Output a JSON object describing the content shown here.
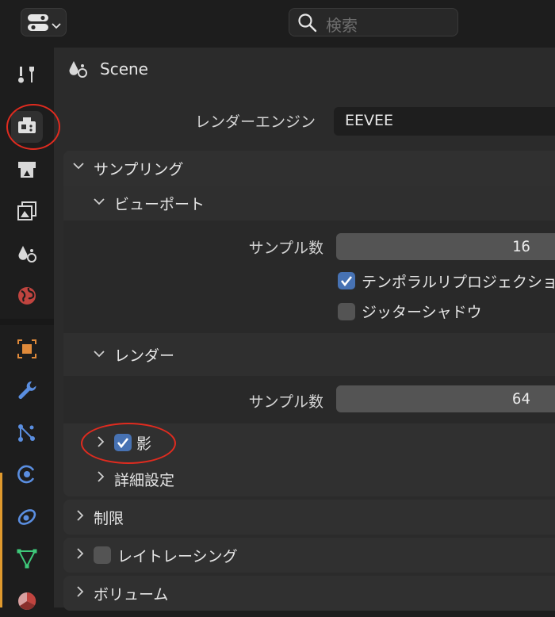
{
  "header": {
    "search_placeholder": "検索"
  },
  "tabs": [
    {
      "name": "tool-tab",
      "icon": "tool-icon"
    },
    {
      "name": "render-tab",
      "icon": "render-icon",
      "active": true
    },
    {
      "name": "output-tab",
      "icon": "output-icon"
    },
    {
      "name": "view-layer-tab",
      "icon": "view-layer-icon"
    },
    {
      "name": "scene-tab",
      "icon": "scene-icon"
    },
    {
      "name": "world-tab",
      "icon": "world-icon"
    },
    {
      "name": "object-tab",
      "icon": "object-icon"
    },
    {
      "name": "modifier-tab",
      "icon": "wrench-icon"
    },
    {
      "name": "particles-tab",
      "icon": "particles-icon"
    },
    {
      "name": "physics-tab",
      "icon": "physics-icon"
    },
    {
      "name": "constraints-tab",
      "icon": "constraint-icon"
    },
    {
      "name": "data-tab",
      "icon": "mesh-data-icon"
    },
    {
      "name": "material-tab",
      "icon": "material-icon"
    }
  ],
  "scene": {
    "label": "Scene"
  },
  "render_engine": {
    "label": "レンダーエンジン",
    "value": "EEVEE"
  },
  "sampling": {
    "title": "サンプリング",
    "viewport": {
      "title": "ビューポート",
      "samples_label": "サンプル数",
      "samples_value": "16",
      "temporal_reprojection": {
        "label": "テンポラルリプロジェクショ",
        "checked": true
      },
      "jittered_shadows": {
        "label": "ジッターシャドウ",
        "checked": false
      }
    },
    "render": {
      "title": "レンダー",
      "samples_label": "サンプル数",
      "samples_value": "64"
    },
    "shadows": {
      "label": "影",
      "checked": true
    },
    "advanced": {
      "label": "詳細設定"
    }
  },
  "panels": {
    "limits": {
      "title": "制限"
    },
    "raytracing": {
      "title": "レイトレーシング",
      "checked": false
    },
    "volumes": {
      "title": "ボリューム"
    }
  },
  "colors": {
    "annotation_red": "#e02b1f",
    "checkbox_blue": "#4772b3",
    "side_accent_orange": "#e09a2e"
  }
}
